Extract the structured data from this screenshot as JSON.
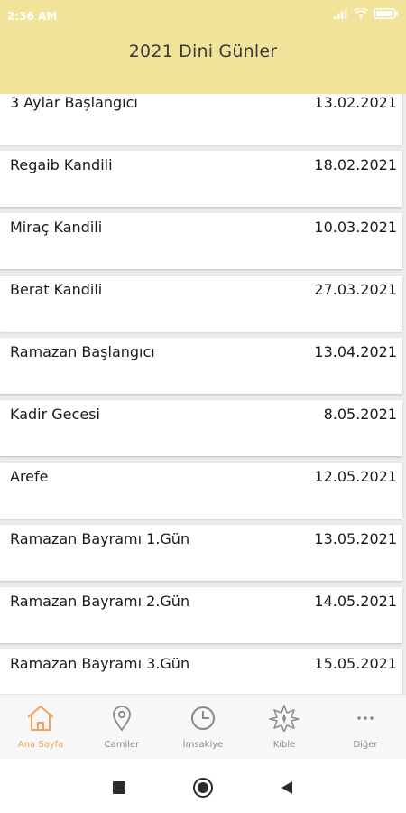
{
  "status_bar": {
    "time": "2:36 AM"
  },
  "header": {
    "title": "2021 Dini Günler"
  },
  "days": [
    {
      "name": "3 Aylar Başlangıcı",
      "date": "13.02.2021"
    },
    {
      "name": "Regaib Kandili",
      "date": "18.02.2021"
    },
    {
      "name": "Miraç Kandili",
      "date": "10.03.2021"
    },
    {
      "name": "Berat Kandili",
      "date": "27.03.2021"
    },
    {
      "name": "Ramazan Başlangıcı",
      "date": "13.04.2021"
    },
    {
      "name": "Kadir Gecesi",
      "date": "8.05.2021"
    },
    {
      "name": "Arefe",
      "date": "12.05.2021"
    },
    {
      "name": "Ramazan Bayramı 1.Gün",
      "date": "13.05.2021"
    },
    {
      "name": "Ramazan Bayramı 2.Gün",
      "date": "14.05.2021"
    },
    {
      "name": "Ramazan Bayramı 3.Gün",
      "date": "15.05.2021"
    }
  ],
  "bottom_nav": {
    "items": [
      {
        "label": "Ana Sayfa",
        "icon": "home-icon",
        "active": true
      },
      {
        "label": "Camiler",
        "icon": "location-pin-icon",
        "active": false
      },
      {
        "label": "İmsakiye",
        "icon": "clock-icon",
        "active": false
      },
      {
        "label": "Kıble",
        "icon": "compass-star-icon",
        "active": false
      },
      {
        "label": "Diğer",
        "icon": "more-dots-icon",
        "active": false
      }
    ]
  },
  "colors": {
    "header_bg": "#f1e49a",
    "active_accent": "#f2a45f",
    "inactive": "#8a8a8a"
  }
}
